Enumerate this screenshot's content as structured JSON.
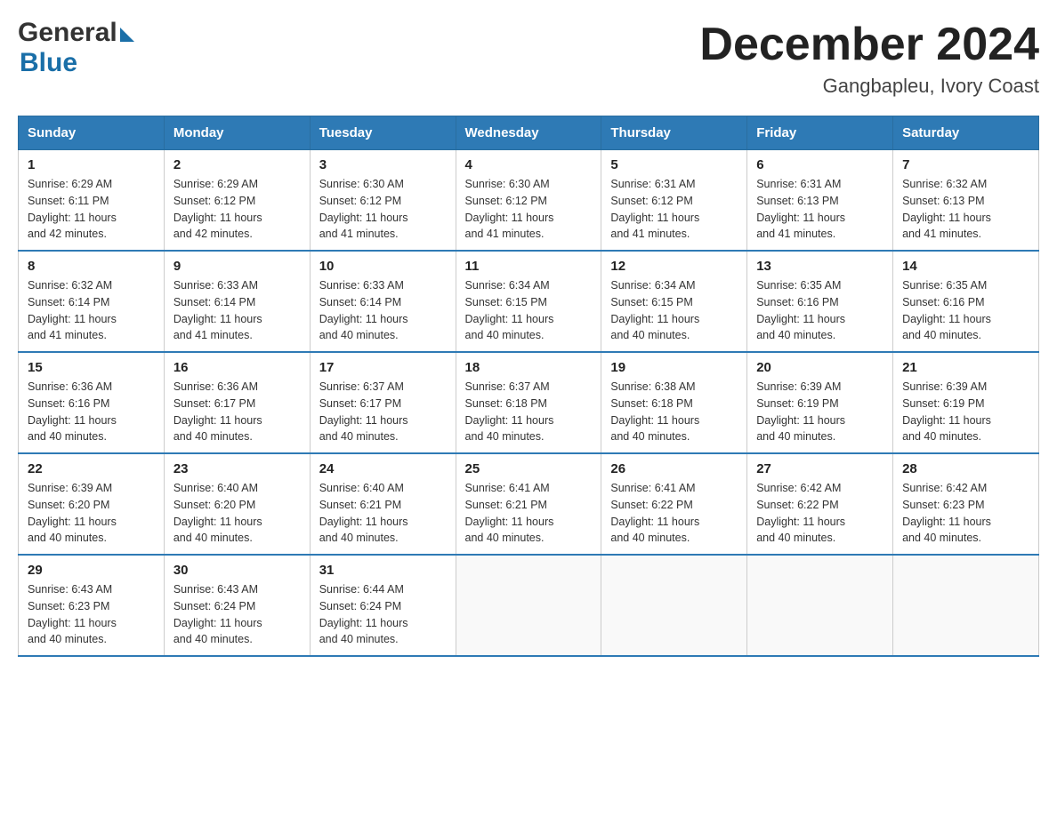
{
  "header": {
    "logo_general": "General",
    "logo_blue": "Blue",
    "month_title": "December 2024",
    "location": "Gangbapleu, Ivory Coast"
  },
  "days_of_week": [
    "Sunday",
    "Monday",
    "Tuesday",
    "Wednesday",
    "Thursday",
    "Friday",
    "Saturday"
  ],
  "weeks": [
    [
      {
        "day": "1",
        "sunrise": "6:29 AM",
        "sunset": "6:11 PM",
        "daylight": "11 hours and 42 minutes."
      },
      {
        "day": "2",
        "sunrise": "6:29 AM",
        "sunset": "6:12 PM",
        "daylight": "11 hours and 42 minutes."
      },
      {
        "day": "3",
        "sunrise": "6:30 AM",
        "sunset": "6:12 PM",
        "daylight": "11 hours and 41 minutes."
      },
      {
        "day": "4",
        "sunrise": "6:30 AM",
        "sunset": "6:12 PM",
        "daylight": "11 hours and 41 minutes."
      },
      {
        "day": "5",
        "sunrise": "6:31 AM",
        "sunset": "6:12 PM",
        "daylight": "11 hours and 41 minutes."
      },
      {
        "day": "6",
        "sunrise": "6:31 AM",
        "sunset": "6:13 PM",
        "daylight": "11 hours and 41 minutes."
      },
      {
        "day": "7",
        "sunrise": "6:32 AM",
        "sunset": "6:13 PM",
        "daylight": "11 hours and 41 minutes."
      }
    ],
    [
      {
        "day": "8",
        "sunrise": "6:32 AM",
        "sunset": "6:14 PM",
        "daylight": "11 hours and 41 minutes."
      },
      {
        "day": "9",
        "sunrise": "6:33 AM",
        "sunset": "6:14 PM",
        "daylight": "11 hours and 41 minutes."
      },
      {
        "day": "10",
        "sunrise": "6:33 AM",
        "sunset": "6:14 PM",
        "daylight": "11 hours and 40 minutes."
      },
      {
        "day": "11",
        "sunrise": "6:34 AM",
        "sunset": "6:15 PM",
        "daylight": "11 hours and 40 minutes."
      },
      {
        "day": "12",
        "sunrise": "6:34 AM",
        "sunset": "6:15 PM",
        "daylight": "11 hours and 40 minutes."
      },
      {
        "day": "13",
        "sunrise": "6:35 AM",
        "sunset": "6:16 PM",
        "daylight": "11 hours and 40 minutes."
      },
      {
        "day": "14",
        "sunrise": "6:35 AM",
        "sunset": "6:16 PM",
        "daylight": "11 hours and 40 minutes."
      }
    ],
    [
      {
        "day": "15",
        "sunrise": "6:36 AM",
        "sunset": "6:16 PM",
        "daylight": "11 hours and 40 minutes."
      },
      {
        "day": "16",
        "sunrise": "6:36 AM",
        "sunset": "6:17 PM",
        "daylight": "11 hours and 40 minutes."
      },
      {
        "day": "17",
        "sunrise": "6:37 AM",
        "sunset": "6:17 PM",
        "daylight": "11 hours and 40 minutes."
      },
      {
        "day": "18",
        "sunrise": "6:37 AM",
        "sunset": "6:18 PM",
        "daylight": "11 hours and 40 minutes."
      },
      {
        "day": "19",
        "sunrise": "6:38 AM",
        "sunset": "6:18 PM",
        "daylight": "11 hours and 40 minutes."
      },
      {
        "day": "20",
        "sunrise": "6:39 AM",
        "sunset": "6:19 PM",
        "daylight": "11 hours and 40 minutes."
      },
      {
        "day": "21",
        "sunrise": "6:39 AM",
        "sunset": "6:19 PM",
        "daylight": "11 hours and 40 minutes."
      }
    ],
    [
      {
        "day": "22",
        "sunrise": "6:39 AM",
        "sunset": "6:20 PM",
        "daylight": "11 hours and 40 minutes."
      },
      {
        "day": "23",
        "sunrise": "6:40 AM",
        "sunset": "6:20 PM",
        "daylight": "11 hours and 40 minutes."
      },
      {
        "day": "24",
        "sunrise": "6:40 AM",
        "sunset": "6:21 PM",
        "daylight": "11 hours and 40 minutes."
      },
      {
        "day": "25",
        "sunrise": "6:41 AM",
        "sunset": "6:21 PM",
        "daylight": "11 hours and 40 minutes."
      },
      {
        "day": "26",
        "sunrise": "6:41 AM",
        "sunset": "6:22 PM",
        "daylight": "11 hours and 40 minutes."
      },
      {
        "day": "27",
        "sunrise": "6:42 AM",
        "sunset": "6:22 PM",
        "daylight": "11 hours and 40 minutes."
      },
      {
        "day": "28",
        "sunrise": "6:42 AM",
        "sunset": "6:23 PM",
        "daylight": "11 hours and 40 minutes."
      }
    ],
    [
      {
        "day": "29",
        "sunrise": "6:43 AM",
        "sunset": "6:23 PM",
        "daylight": "11 hours and 40 minutes."
      },
      {
        "day": "30",
        "sunrise": "6:43 AM",
        "sunset": "6:24 PM",
        "daylight": "11 hours and 40 minutes."
      },
      {
        "day": "31",
        "sunrise": "6:44 AM",
        "sunset": "6:24 PM",
        "daylight": "11 hours and 40 minutes."
      },
      null,
      null,
      null,
      null
    ]
  ],
  "labels": {
    "sunrise": "Sunrise:",
    "sunset": "Sunset:",
    "daylight": "Daylight:"
  }
}
